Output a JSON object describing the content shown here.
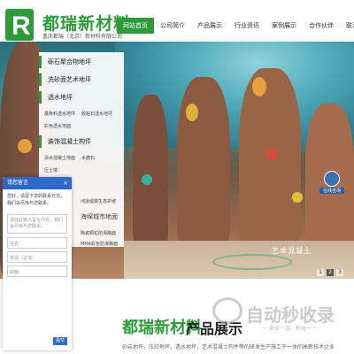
{
  "header": {
    "logo_letter": "R",
    "brand_name": "都瑞新材料",
    "brand_sub": "重庆都瑞（北京）新材料有限公司",
    "nav": [
      "网站首页",
      "公司简介",
      "产品展示",
      "行业资讯",
      "案例展示",
      "合作伙伴",
      "联系我们"
    ],
    "active_nav": "网站首页"
  },
  "menu": {
    "items": [
      "砾石聚合物地坪",
      "洗砂面艺术地坪",
      "透水地坪",
      "装饰混凝土构件"
    ],
    "sub_items": [
      "露骨料透水地坪",
      "胶粘石透水地坪",
      "彩色透水地面",
      "清水混凝土地面",
      "水磨石",
      "压土墙"
    ]
  },
  "hero": {
    "caption": "艺术混凝土",
    "pages": [
      "1",
      "2",
      "3"
    ],
    "active_page": "2",
    "extra_lines": [
      "河道堤岸生态护坡",
      "海绵城市地面",
      "陶瓷颗粒防滑路面",
      "MMA彩色防滑路面"
    ],
    "avatar_label": "在线咨询"
  },
  "chat": {
    "title": "请您留言",
    "close": "×",
    "greeting": "您好，请留下您的联系方式，我们会尽快与您联系。",
    "message_placeholder": "请在此输入留言内容，我们会尽快与您联系。",
    "name_placeholder": "姓名",
    "phone_placeholder": "电话（必填）",
    "email_placeholder": "邮箱",
    "send": "提交"
  },
  "footer_section": {
    "title_green": "都瑞新材料",
    "title_dark": "产品展示",
    "desc": "砂岩地坪，压印地坪，透水地坪，艺术混凝土构件等的研发生产施工于一体的高新技术企业"
  },
  "watermark": {
    "text": "自动秒收录",
    "sub": "一 来访一次，秒收一 一"
  },
  "colors": {
    "brand_green": "#2e9b3a",
    "chat_blue": "#2f68c8"
  }
}
